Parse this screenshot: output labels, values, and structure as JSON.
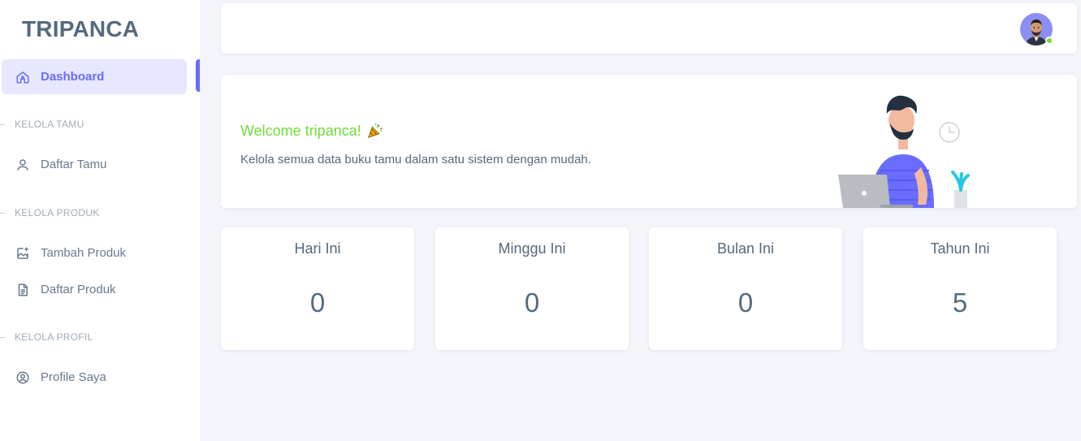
{
  "brand": "TRIPANCA",
  "sidebar": {
    "dashboard_label": "Dashboard",
    "sections": {
      "tamu": "KELOLA TAMU",
      "produk": "KELOLA PRODUK",
      "profil": "KELOLA PROFIL"
    },
    "items": {
      "daftar_tamu": "Daftar Tamu",
      "tambah_produk": "Tambah Produk",
      "daftar_produk": "Daftar Produk",
      "profile_saya": "Profile Saya"
    }
  },
  "welcome": {
    "title": "Welcome tripanca!",
    "text": "Kelola semua data buku tamu dalam satu sistem dengan mudah."
  },
  "stats": [
    {
      "label": "Hari Ini",
      "value": "0"
    },
    {
      "label": "Minggu Ini",
      "value": "0"
    },
    {
      "label": "Bulan Ini",
      "value": "0"
    },
    {
      "label": "Tahun Ini",
      "value": "5"
    }
  ],
  "colors": {
    "accent": "#696cff",
    "success": "#71dd37",
    "text": "#566a7f"
  },
  "icons": {
    "dashboard": "home-icon",
    "daftar_tamu": "user-icon",
    "tambah_produk": "image-add-icon",
    "daftar_produk": "file-text-icon",
    "profile_saya": "user-circle-icon"
  }
}
